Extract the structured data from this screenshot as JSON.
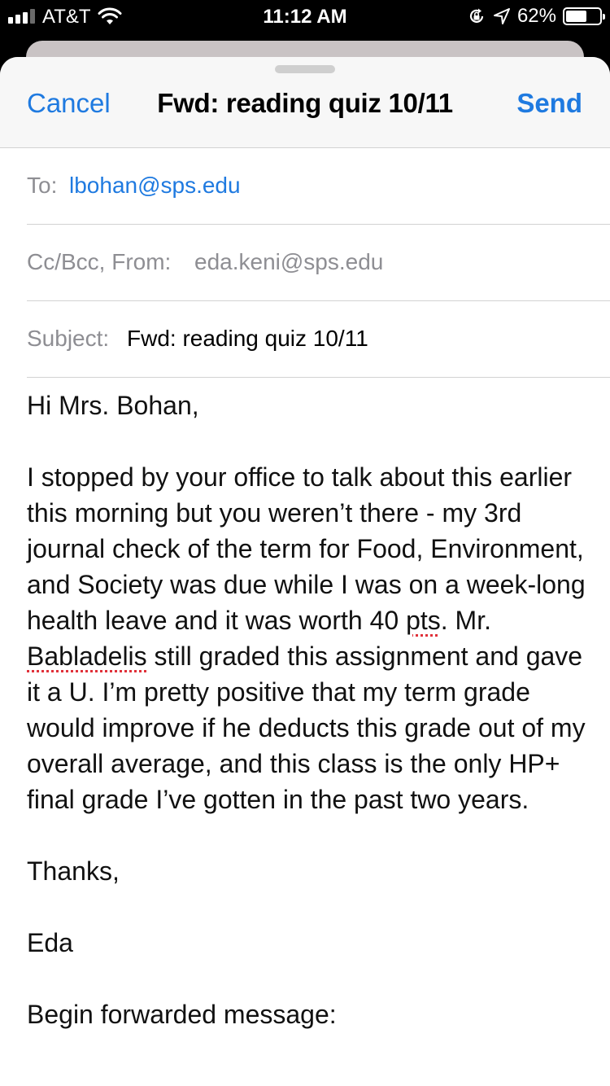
{
  "status_bar": {
    "carrier": "AT&T",
    "time": "11:12 AM",
    "battery_percent_label": "62%",
    "battery_level": 0.62,
    "signal_bars_active": 3,
    "signal_bars_total": 4,
    "icons": [
      "signal-icon",
      "wifi-icon",
      "rotation-lock-icon",
      "location-icon",
      "battery-icon"
    ]
  },
  "nav": {
    "cancel_label": "Cancel",
    "title": "Fwd: reading quiz 10/11",
    "send_label": "Send",
    "accent_color": "#1f7ae0"
  },
  "fields": {
    "to_label": "To:",
    "to_value": "lbohan@sps.edu",
    "cc_from_label": "Cc/Bcc, From:",
    "from_value": "eda.keni@sps.edu",
    "subject_label": "Subject:",
    "subject_value": "Fwd: reading quiz 10/11"
  },
  "body": {
    "greeting": "Hi Mrs. Bohan,",
    "paragraph_part1": "I stopped by your office to talk about this earlier this morning but you weren’t there - my 3rd journal check of the term for Food, Environment, and Society was due while I was on a week-long health leave and it was worth 40 ",
    "misspelled_1": "pts",
    "paragraph_part2": ". Mr. ",
    "misspelled_2": "Babladelis",
    "paragraph_part3": " still graded this assignment and gave it a U. I’m pretty positive that my term grade would improve if he deducts this grade out of my overall average, and this class is the only HP+ final grade I’ve gotten in the past two years.",
    "signoff": "Thanks,",
    "signature": "Eda",
    "forward_header": "Begin forwarded message:"
  }
}
